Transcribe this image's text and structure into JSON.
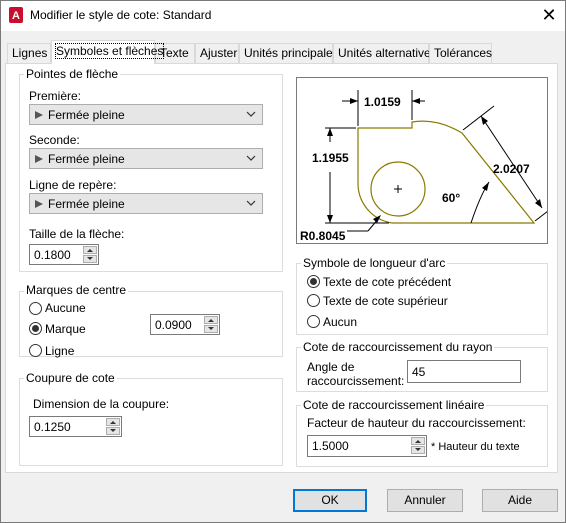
{
  "window": {
    "title": "Modifier le style de cote: Standard",
    "close_glyph": "✕",
    "app_icon": "autocad-icon"
  },
  "tabs": [
    {
      "label": "Lignes"
    },
    {
      "label": "Symboles et flèches"
    },
    {
      "label": "Texte"
    },
    {
      "label": "Ajuster"
    },
    {
      "label": "Unités principales"
    },
    {
      "label": "Unités alternatives"
    },
    {
      "label": "Tolérances"
    }
  ],
  "arrowheads": {
    "group_label": "Pointes de flèche",
    "first_label": "Première:",
    "first_value": "Fermée pleine",
    "second_label": "Seconde:",
    "second_value": "Fermée pleine",
    "leader_label": "Ligne de repère:",
    "leader_value": "Fermée pleine",
    "size_label": "Taille de la flèche:",
    "size_value": "0.1800"
  },
  "center_marks": {
    "group_label": "Marques de centre",
    "options": [
      {
        "label": "Aucune"
      },
      {
        "label": "Marque"
      },
      {
        "label": "Ligne"
      }
    ],
    "selected": "Marque",
    "size_value": "0.0900"
  },
  "dim_break": {
    "group_label": "Coupure de cote",
    "size_label": "Dimension de la coupure:",
    "size_value": "0.1250"
  },
  "preview": {
    "top_dim": "1.0159",
    "left_dim": "1.1955",
    "right_dim": "2.0207",
    "angle": "60°",
    "radius": "R0.8045"
  },
  "arc_length": {
    "group_label": "Symbole de longueur d'arc",
    "options": [
      {
        "label": "Texte de cote précédent"
      },
      {
        "label": "Texte de cote supérieur"
      },
      {
        "label": "Aucun"
      }
    ],
    "selected": "Texte de cote précédent"
  },
  "radius_jog": {
    "group_label": "Cote de raccourcissement du rayon",
    "angle_label_1": "Angle de",
    "angle_label_2": "raccourcissement:",
    "angle_value": "45"
  },
  "linear_jog": {
    "group_label": "Cote de raccourcissement linéaire",
    "factor_label": "Facteur de hauteur du raccourcissement:",
    "factor_value": "1.5000",
    "suffix": "* Hauteur du texte"
  },
  "buttons": {
    "ok": "OK",
    "cancel": "Annuler",
    "help": "Aide"
  },
  "colors": {
    "accent": "#0078d7",
    "app_icon": "#c8102e",
    "preview_shape": "#8a7a00"
  }
}
